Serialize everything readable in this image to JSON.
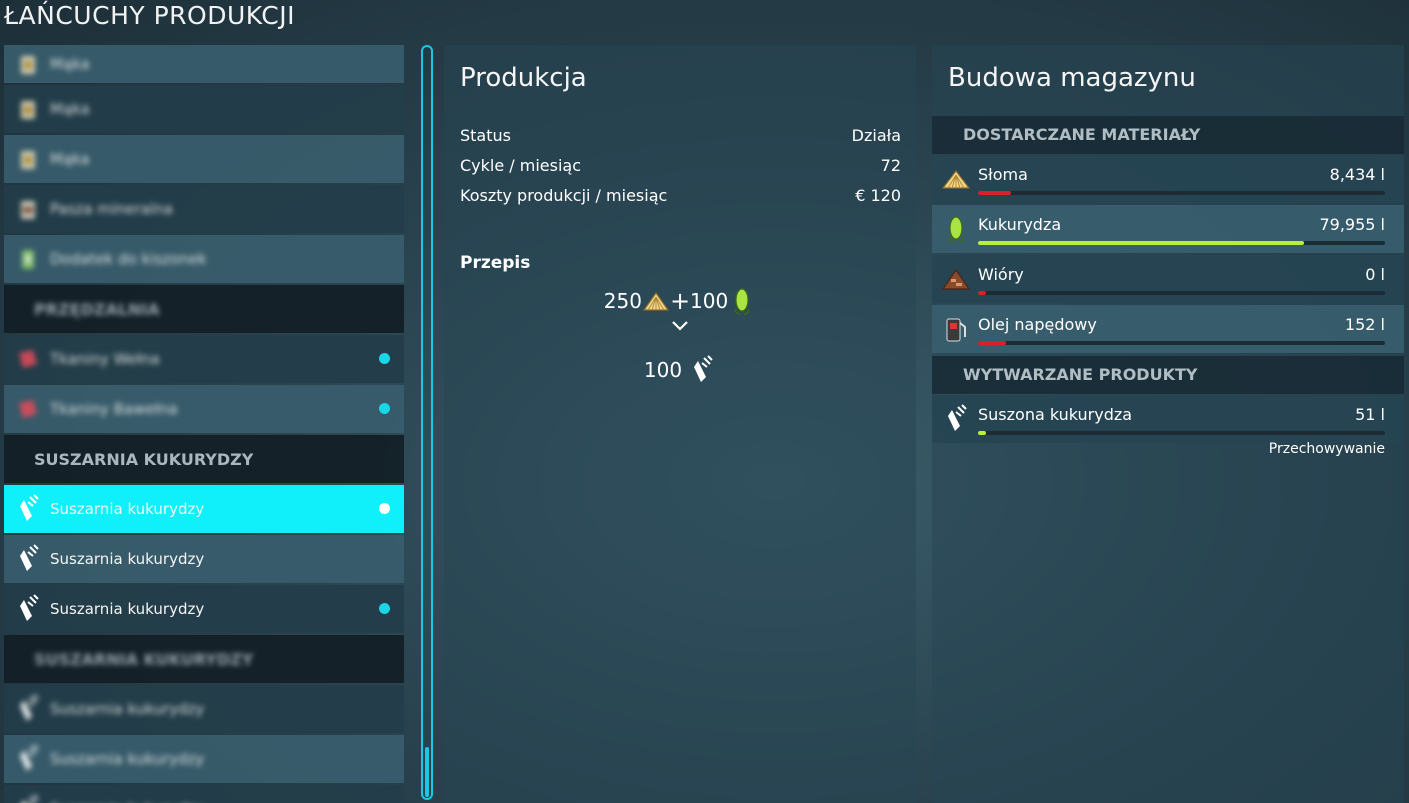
{
  "page_title": "ŁAŃCUCHY PRODUKCJI",
  "left_list": {
    "items": [
      {
        "type": "item",
        "label": "Mąka",
        "icon": "flour-bag-icon",
        "blurred": true,
        "style": "alt1",
        "dot": false,
        "partial": true
      },
      {
        "type": "item",
        "label": "Mąka",
        "icon": "flour-bag-icon",
        "blurred": true,
        "style": "alt2",
        "dot": false
      },
      {
        "type": "item",
        "label": "Mąka",
        "icon": "flour-bag-icon",
        "blurred": true,
        "style": "alt1",
        "dot": false
      },
      {
        "type": "item",
        "label": "Pasza mineralna",
        "icon": "mineral-feed-icon",
        "blurred": true,
        "style": "alt2",
        "dot": false
      },
      {
        "type": "item",
        "label": "Dodatek do kiszonek",
        "icon": "silage-additive-icon",
        "blurred": true,
        "style": "alt1",
        "dot": false
      },
      {
        "type": "cat",
        "label": "PRZĘDZALNIA",
        "blurred": true
      },
      {
        "type": "item",
        "label": "Tkaniny Wełna",
        "icon": "fabric-icon",
        "blurred": true,
        "style": "alt2",
        "dot": true
      },
      {
        "type": "item",
        "label": "Tkaniny Bawełna",
        "icon": "fabric-icon",
        "blurred": true,
        "style": "alt1",
        "dot": true
      },
      {
        "type": "cat",
        "label": "SUSZARNIA KUKURYDZY",
        "blurred": false
      },
      {
        "type": "item",
        "label": "Suszarnia kukurydzy",
        "icon": "dried-corn-icon",
        "blurred": false,
        "style": "selected",
        "dot": true
      },
      {
        "type": "item",
        "label": "Suszarnia kukurydzy",
        "icon": "dried-corn-icon",
        "blurred": false,
        "style": "alt1",
        "dot": false
      },
      {
        "type": "item",
        "label": "Suszarnia kukurydzy",
        "icon": "dried-corn-icon",
        "blurred": false,
        "style": "alt2",
        "dot": true
      },
      {
        "type": "cat",
        "label": "SUSZARNIA KUKURYDZY",
        "blurred": true
      },
      {
        "type": "item",
        "label": "Suszarnia kukurydzy",
        "icon": "dried-corn-icon",
        "blurred": true,
        "style": "alt2",
        "dot": false
      },
      {
        "type": "item",
        "label": "Suszarnia kukurydzy",
        "icon": "dried-corn-icon",
        "blurred": true,
        "style": "alt1",
        "dot": false
      },
      {
        "type": "item",
        "label": "Suszarnia kukurydzy",
        "icon": "dried-corn-icon",
        "blurred": true,
        "style": "alt2",
        "dot": false
      }
    ]
  },
  "production": {
    "title": "Produkcja",
    "stats": [
      {
        "label": "Status",
        "value": "Działa"
      },
      {
        "label": "Cykle / miesiąc",
        "value": "72"
      },
      {
        "label": "Koszty produkcji / miesiąc",
        "value": "€ 120"
      }
    ],
    "recipe_label": "Przepis",
    "recipe": {
      "input1_amount": "250",
      "input1_icon": "straw-icon",
      "plus": "+",
      "input2_amount": "100",
      "input2_icon": "corn-icon",
      "arrow": "⌄",
      "output_amount": "100",
      "output_icon": "dried-corn-icon"
    }
  },
  "storage": {
    "title": "Budowa magazynu",
    "supplied_header": "DOSTARCZANE MATERIAŁY",
    "materials": [
      {
        "name": "Słoma",
        "amount": "8,434 l",
        "icon": "straw-icon",
        "fill": 0.08,
        "color": "#d9202b"
      },
      {
        "name": "Kukurydza",
        "amount": "79,955 l",
        "icon": "corn-icon",
        "fill": 0.8,
        "color": "#b6f03c"
      },
      {
        "name": "Wióry",
        "amount": "0 l",
        "icon": "wood-chips-icon",
        "fill": 0.02,
        "color": "#d9202b"
      },
      {
        "name": "Olej napędowy",
        "amount": "152 l",
        "icon": "diesel-icon",
        "fill": 0.07,
        "color": "#d9202b"
      }
    ],
    "produced_header": "WYTWARZANE PRODUKTY",
    "products": [
      {
        "name": "Suszona kukurydza",
        "amount": "51 l",
        "icon": "dried-corn-icon",
        "fill": 0.02,
        "color": "#b6f03c"
      }
    ],
    "storage_label": "Przechowywanie"
  }
}
